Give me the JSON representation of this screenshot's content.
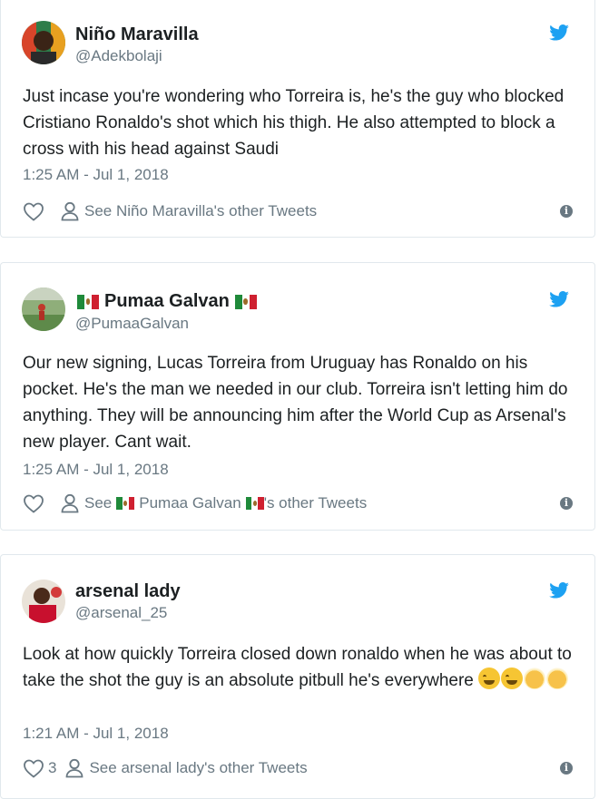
{
  "tweets": [
    {
      "author": "Niño Maravilla",
      "handle": "@Adekbolaji",
      "text": "Just incase you're wondering who Torreira is, he's the guy who blocked Cristiano Ronaldo's shot which his thigh. He also attempted to block a cross with his head against Saudi",
      "timestamp": "1:25 AM - Jul 1, 2018",
      "like_count": "",
      "other_tweets_label": "See Niño Maravilla's other Tweets"
    },
    {
      "author": "Pumaa Galvan",
      "handle": "@PumaaGalvan",
      "text": "Our new signing, Lucas Torreira from Uruguay has Ronaldo on his pocket. He's the man we needed in our club. Torreira isn't letting him do anything. They will be announcing him after the World Cup as Arsenal's new player. Cant wait.",
      "timestamp": "1:25 AM - Jul 1, 2018",
      "like_count": "",
      "other_tweets_prefix": "See",
      "other_tweets_name": "Pumaa Galvan",
      "other_tweets_suffix": "'s other Tweets"
    },
    {
      "author": "arsenal lady",
      "handle": "@arsenal_25",
      "text": "Look at how quickly Torreira closed down ronaldo when he was about to take the shot the guy is an absolute pitbull he's everywhere",
      "timestamp": "1:21 AM - Jul 1, 2018",
      "like_count": "3",
      "other_tweets_label": "See arsenal lady's other Tweets"
    }
  ],
  "icons": {
    "brand": "twitter-bird-icon",
    "like": "heart-icon",
    "profile": "person-icon",
    "info": "info-icon",
    "flag": "mexico-flag-icon"
  },
  "colors": {
    "twitter_blue": "#1da1f2",
    "secondary_text": "#697882",
    "border": "#e1e8ed"
  },
  "info_glyph": "i"
}
